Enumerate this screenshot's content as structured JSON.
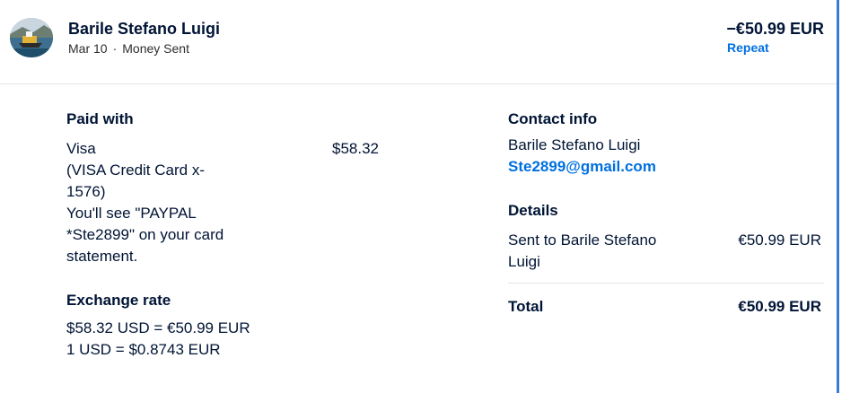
{
  "transaction": {
    "name": "Barile Stefano Luigi",
    "date": "Mar 10",
    "type": "Money Sent",
    "amount": "−€50.99 EUR",
    "repeat_label": "Repeat"
  },
  "paid_with": {
    "title": "Paid with",
    "method": "Visa",
    "card_line1": "(VISA Credit Card x-",
    "card_line2": "1576)",
    "note_line1": "You'll see \"PAYPAL",
    "note_line2": "*Ste2899\" on your card",
    "note_line3": "statement.",
    "amount": "$58.32"
  },
  "exchange": {
    "title": "Exchange rate",
    "line1": "$58.32 USD = €50.99 EUR",
    "line2": "1 USD = $0.8743 EUR"
  },
  "contact": {
    "title": "Contact info",
    "name": "Barile Stefano Luigi",
    "email": "Ste2899@gmail.com"
  },
  "details": {
    "title": "Details",
    "sent_to_line1": "Sent to Barile Stefano",
    "sent_to_line2": "Luigi",
    "sent_amount": "€50.99 EUR",
    "total_label": "Total",
    "total_amount": "€50.99 EUR"
  },
  "colors": {
    "link": "#0070e0",
    "text": "#001435",
    "accent_border": "#3a7bd5"
  },
  "icons": {
    "avatar": "boat-photo-avatar"
  }
}
